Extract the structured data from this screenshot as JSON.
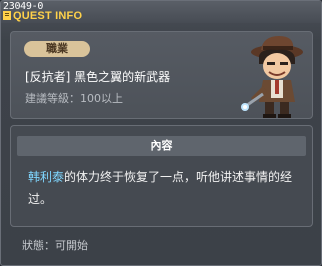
{
  "window": {
    "quest_id": "23049-0",
    "title": "QUEST INFO"
  },
  "quest": {
    "category_badge": "職業",
    "name": "[反抗者] 黑色之翼的新武器",
    "level_requirement": "建議等級：100以上",
    "npc_portrait_icon": "npc-portrait-icon"
  },
  "content": {
    "header": "內容",
    "npc_name": "韩利泰",
    "text": "的体力终于恢复了一点，听他讲述事情的经过。"
  },
  "status": {
    "text": "狀態：可開始"
  },
  "colors": {
    "title": "#ffd24a",
    "npc_name": "#7fd6ff",
    "badge": "#d9c39a"
  }
}
